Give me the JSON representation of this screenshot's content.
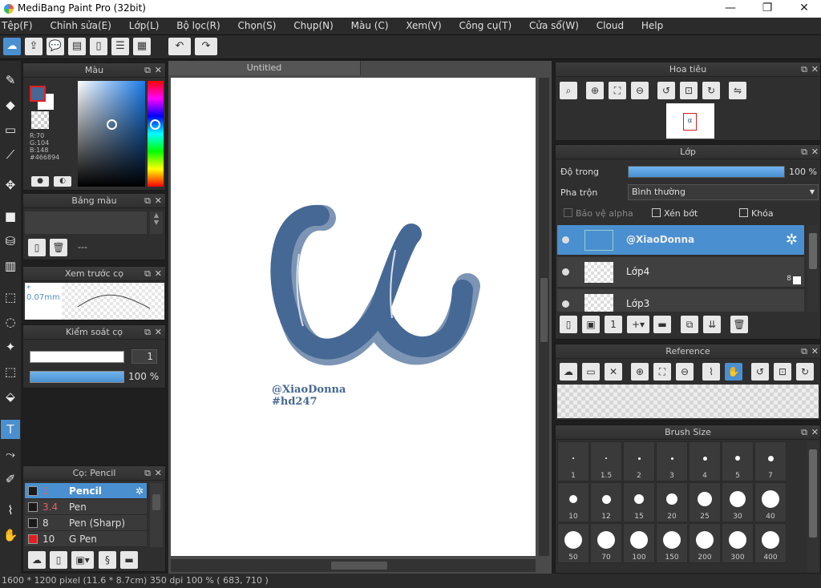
{
  "title": "MediBang Paint Pro (32bit)",
  "window_controls": {
    "minimize": "—",
    "maximize": "❐",
    "close": "✕"
  },
  "menu": [
    "Tệp(F)",
    "Chỉnh sửa(E)",
    "Lớp(L)",
    "Bộ lọc(R)",
    "Chọn(S)",
    "Chụp(N)",
    "Màu (C)",
    "Xem(V)",
    "Công cụ(T)",
    "Cửa sổ(W)",
    "Cloud",
    "Help"
  ],
  "color_panel": {
    "title": "Màu",
    "r": "R:70",
    "g": "G:104",
    "b": "B:148",
    "hex": "#466894",
    "primary_color": "#466894"
  },
  "palette_panel": {
    "title": "Bảng màu",
    "dash": "---"
  },
  "brush_preview": {
    "title": "Xem trước cọ",
    "size": "* 0.07mm"
  },
  "brush_control": {
    "title": "Kiểm soát cọ",
    "size_value": "1",
    "opacity": "100 %"
  },
  "brush_list": {
    "title": "Cọ: Pencil",
    "items": [
      {
        "size": "1",
        "name": "Pencil",
        "color": "#1a1a1a"
      },
      {
        "size": "3.4",
        "name": "Pen",
        "color": "#1a1a1a"
      },
      {
        "size": "8",
        "name": "Pen (Sharp)",
        "color": "#1a1a1a"
      },
      {
        "size": "10",
        "name": "G Pen",
        "color": "#e02020"
      }
    ]
  },
  "canvas": {
    "tab": "Untitled",
    "signature_line1": "@XiaoDonna",
    "signature_line2": "#hd247",
    "letter_color": "#466894"
  },
  "navigator": {
    "title": "Hoa tiêu",
    "thumb_text": "α"
  },
  "layers": {
    "title": "Lớp",
    "opacity_label": "Độ trong",
    "opacity_value": "100 %",
    "opacity_fraction": 1.0,
    "blend_label": "Pha trộn",
    "blend_value": "Bình thường",
    "protect_alpha": "Bảo vệ alpha",
    "clipping": "Xén bớt",
    "lock": "Khóa",
    "items": [
      {
        "name": "@XiaoDonna",
        "selected": true
      },
      {
        "name": "Lớp4",
        "selected": false
      },
      {
        "name": "Lớp3",
        "selected": false
      }
    ],
    "layer4_badge": "8"
  },
  "reference": {
    "title": "Reference"
  },
  "brush_size": {
    "title": "Brush Size",
    "sizes": [
      "1",
      "1.5",
      "2",
      "3",
      "4",
      "5",
      "7",
      "10",
      "12",
      "15",
      "20",
      "25",
      "30",
      "40",
      "50",
      "70",
      "100",
      "150",
      "200",
      "300",
      "400"
    ]
  },
  "status": {
    "text": "1600 * 1200 pixel   (11.6 * 8.7cm)   350 dpi   100 %   ( 683, 710 )"
  }
}
